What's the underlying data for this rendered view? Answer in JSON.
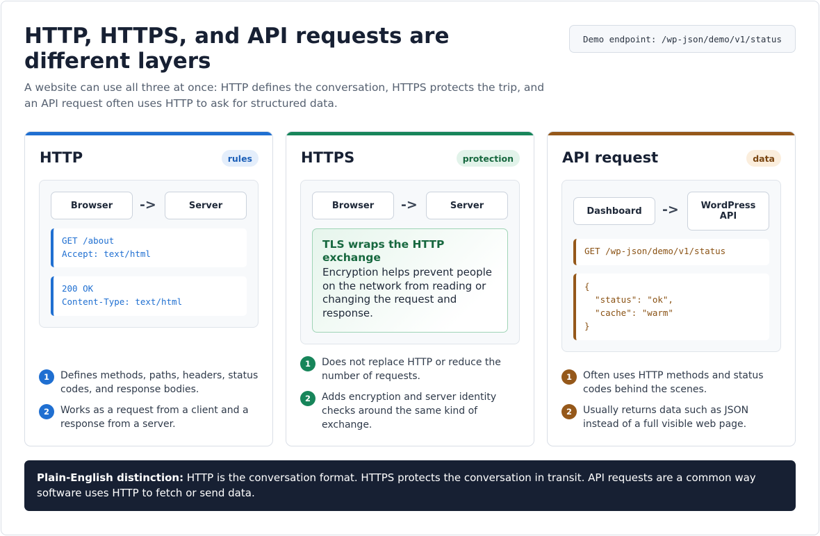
{
  "header": {
    "title": "HTTP, HTTPS, and API requests are different layers",
    "subtitle": "A website can use all three at once: HTTP defines the conversation, HTTPS protects the trip, and an API request often uses HTTP to ask for structured data.",
    "endpoint": "Demo endpoint: /wp-json/demo/v1/status"
  },
  "cards": [
    {
      "title": "HTTP",
      "badge": "rules",
      "accent": "#1f6fd1",
      "from": "Browser",
      "arrow": "->",
      "to": "Server",
      "request": "GET /about\nAccept: text/html",
      "response": "200 OK\nContent-Type: text/html",
      "points": [
        {
          "n": "1",
          "text": "Defines methods, paths, headers, status codes, and response bodies."
        },
        {
          "n": "2",
          "text": "Works as a request from a client and a response from a server."
        }
      ]
    },
    {
      "title": "HTTPS",
      "badge": "protection",
      "accent": "#17855a",
      "from": "Browser",
      "arrow": "->",
      "to": "Server",
      "tls_title": "TLS wraps the HTTP exchange",
      "tls_body": "Encryption helps prevent people on the network from reading or changing the request and response.",
      "points": [
        {
          "n": "1",
          "text": "Does not replace HTTP or reduce the number of requests."
        },
        {
          "n": "2",
          "text": "Adds encryption and server identity checks around the same kind of exchange."
        }
      ]
    },
    {
      "title": "API request",
      "badge": "data",
      "accent": "#95581a",
      "from": "Dashboard",
      "arrow": "->",
      "to": "WordPress API",
      "request": "GET /wp-json/demo/v1/status",
      "response": "{\n  \"status\": \"ok\",\n  \"cache\": \"warm\"\n}",
      "points": [
        {
          "n": "1",
          "text": "Often uses HTTP methods and status codes behind the scenes."
        },
        {
          "n": "2",
          "text": "Usually returns data such as JSON instead of a full visible web page."
        }
      ]
    }
  ],
  "summary": {
    "label": "Plain-English distinction:",
    "text": " HTTP is the conversation format. HTTPS protects the conversation in transit. API requests are a common way software uses HTTP to fetch or send data."
  }
}
